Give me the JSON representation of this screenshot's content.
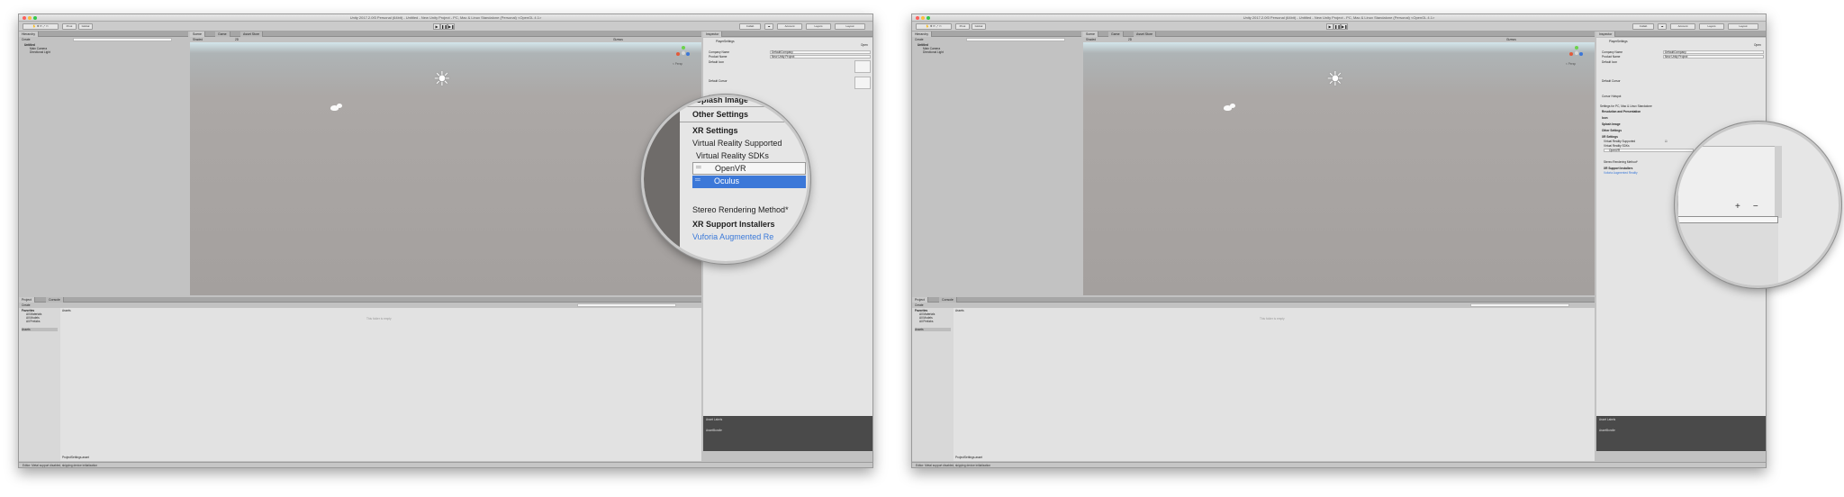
{
  "window_title_left": "Unity 2017.2.0f3 Personal (64bit) - Untitled - New Unity Project - PC, Mac & Linux Standalone (Personal) <OpenGL 4.1>",
  "window_title_right": "Unity 2017.2.0f3 Personal (64bit) - Untitled - New Unity Project - PC, Mac & Linux Standalone (Personal) <OpenGL 4.1>",
  "toolbar": {
    "pivot": "Pivot",
    "global": "Global",
    "collab": "Collab",
    "account": "Account",
    "layers": "Layers",
    "layout": "Layout"
  },
  "hierarchy": {
    "tab": "Hierarchy",
    "create": "Create",
    "scene": "Untitled",
    "items": [
      "Main Camera",
      "Directional Light"
    ]
  },
  "scene": {
    "tabs": [
      "Scene",
      "Game",
      "Asset Store"
    ],
    "shaded": "Shaded",
    "mode_2d": "2D",
    "gizmos": "Gizmos",
    "persp": "< Persp"
  },
  "project": {
    "tabs": [
      "Project",
      "Console"
    ],
    "create": "Create",
    "favorites_header": "Favorites",
    "favorites": [
      "All Materials",
      "All Models",
      "All Prefabs"
    ],
    "assets_root": "Assets",
    "assets_header": "Assets",
    "empty_text": "This folder is empty",
    "footer_path": "ProjectSettings.asset"
  },
  "status_text": "Editor: Metal support disabled, skipping device initialization",
  "inspector": {
    "tab": "Inspector",
    "title": "PlayerSettings",
    "open": "Open",
    "fields": [
      {
        "label": "Company Name",
        "value": "DefaultCompany"
      },
      {
        "label": "Product Name",
        "value": "New Unity Project"
      }
    ],
    "default_icon": "Default Icon",
    "default_cursor": "Default Cursor",
    "cursor_hotspot": "Cursor Hotspot",
    "platform_settings": "Settings for PC, Mac & Linux Standalone",
    "sections": [
      "Resolution and Presentation",
      "Icon",
      "Splash Image",
      "Other Settings",
      "XR Settings"
    ],
    "preview": "Asset Labels",
    "bundle_label": "AssetBundle"
  },
  "zoom_left": {
    "splash_image": "Splash Image",
    "other_settings": "Other Settings",
    "xr_settings": "XR Settings",
    "vr_supported": "Virtual Reality Supported",
    "vr_sdks": "Virtual Reality SDKs",
    "sdk_items": [
      "OpenVR",
      "Oculus"
    ],
    "selected_sdk": "Oculus",
    "stereo_method": "Stereo Rendering Method*",
    "xr_installers": "XR Support Installers",
    "vuforia": "Vuforia Augmented Re"
  },
  "right_panel": {
    "xr_settings": "XR Settings",
    "vr_supported": "Virtual Reality Supported",
    "vr_sdks": "Virtual Reality SDKs",
    "sdk_item": "OpenVR",
    "stereo_method": "Stereo Rendering Method*",
    "xr_installers": "XR Support Installers",
    "vuforia": "Vuforia Augmented Reality",
    "plus": "+",
    "minus": "−"
  },
  "colors": {
    "selection": "#3c78d8",
    "link": "#3a79d9",
    "panel": "#c2c2c2"
  }
}
